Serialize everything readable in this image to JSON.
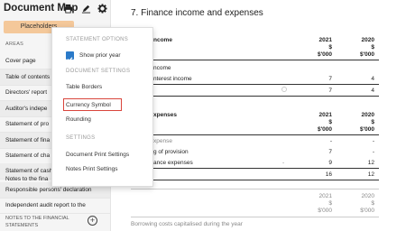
{
  "sidebar": {
    "title": "Document Map",
    "placeholders_button": "Placeholders",
    "areas_heading": "AREAS",
    "items": [
      "Cover page",
      "Table of contents",
      "Directors' report",
      "Auditor's indepe",
      "Statement of pro",
      "Statement of fina",
      "Statement of cha",
      "Statement of cash",
      "Notes to the fina",
      "Responsible persons' declaration",
      "Independent audit report to the"
    ],
    "bottom_line1": "NOTES TO THE FINANCIAL",
    "bottom_line2": "STATEMENTS",
    "add_icon": "+"
  },
  "toolbar": {
    "print_icon": "printer-icon",
    "edit_icon": "pen-icon",
    "settings_icon": "gear-icon"
  },
  "dropdown": {
    "statement_options_heading": "STATEMENT OPTIONS",
    "show_prior_year": "Show prior year",
    "document_settings_heading": "DOCUMENT SETTINGS",
    "table_borders": "Table Borders",
    "currency_symbol": "Currency Symbol",
    "rounding": "Rounding",
    "settings_heading": "SETTINGS",
    "document_print_settings": "Document Print Settings",
    "notes_print_settings": "Notes Print Settings"
  },
  "document": {
    "title": "7. Finance income and expenses",
    "income_section": {
      "header_label": "ncome",
      "col_2021": [
        "2021",
        "$",
        "$'000"
      ],
      "col_2020": [
        "2020",
        "$",
        "$'000"
      ],
      "sub_label": "ncome",
      "rows": [
        {
          "label": "nterest income",
          "v2021": "7",
          "v2020": "4"
        },
        {
          "label": "",
          "v2021": "7",
          "v2020": "4"
        }
      ]
    },
    "expenses_section": {
      "header_label": "xpenses",
      "col_2021": [
        "2021",
        "$",
        "$'000"
      ],
      "col_2020": [
        "2020",
        "$",
        "$'000"
      ],
      "rows": [
        {
          "label": "xpense",
          "v2021": "-",
          "v2020": "-"
        },
        {
          "label": "g of provision",
          "v2021": "7",
          "v2020": "-"
        },
        {
          "label": "ance expenses",
          "v2021": "9",
          "v2020": "12"
        },
        {
          "label": "",
          "v2021": "16",
          "v2020": "12"
        }
      ]
    },
    "third_section": {
      "col_2021": [
        "2021",
        "$",
        "$'000"
      ],
      "col_2020": [
        "2020",
        "$",
        "$'000"
      ],
      "footer_label": "Borrowing costs capitalised during the year"
    }
  }
}
